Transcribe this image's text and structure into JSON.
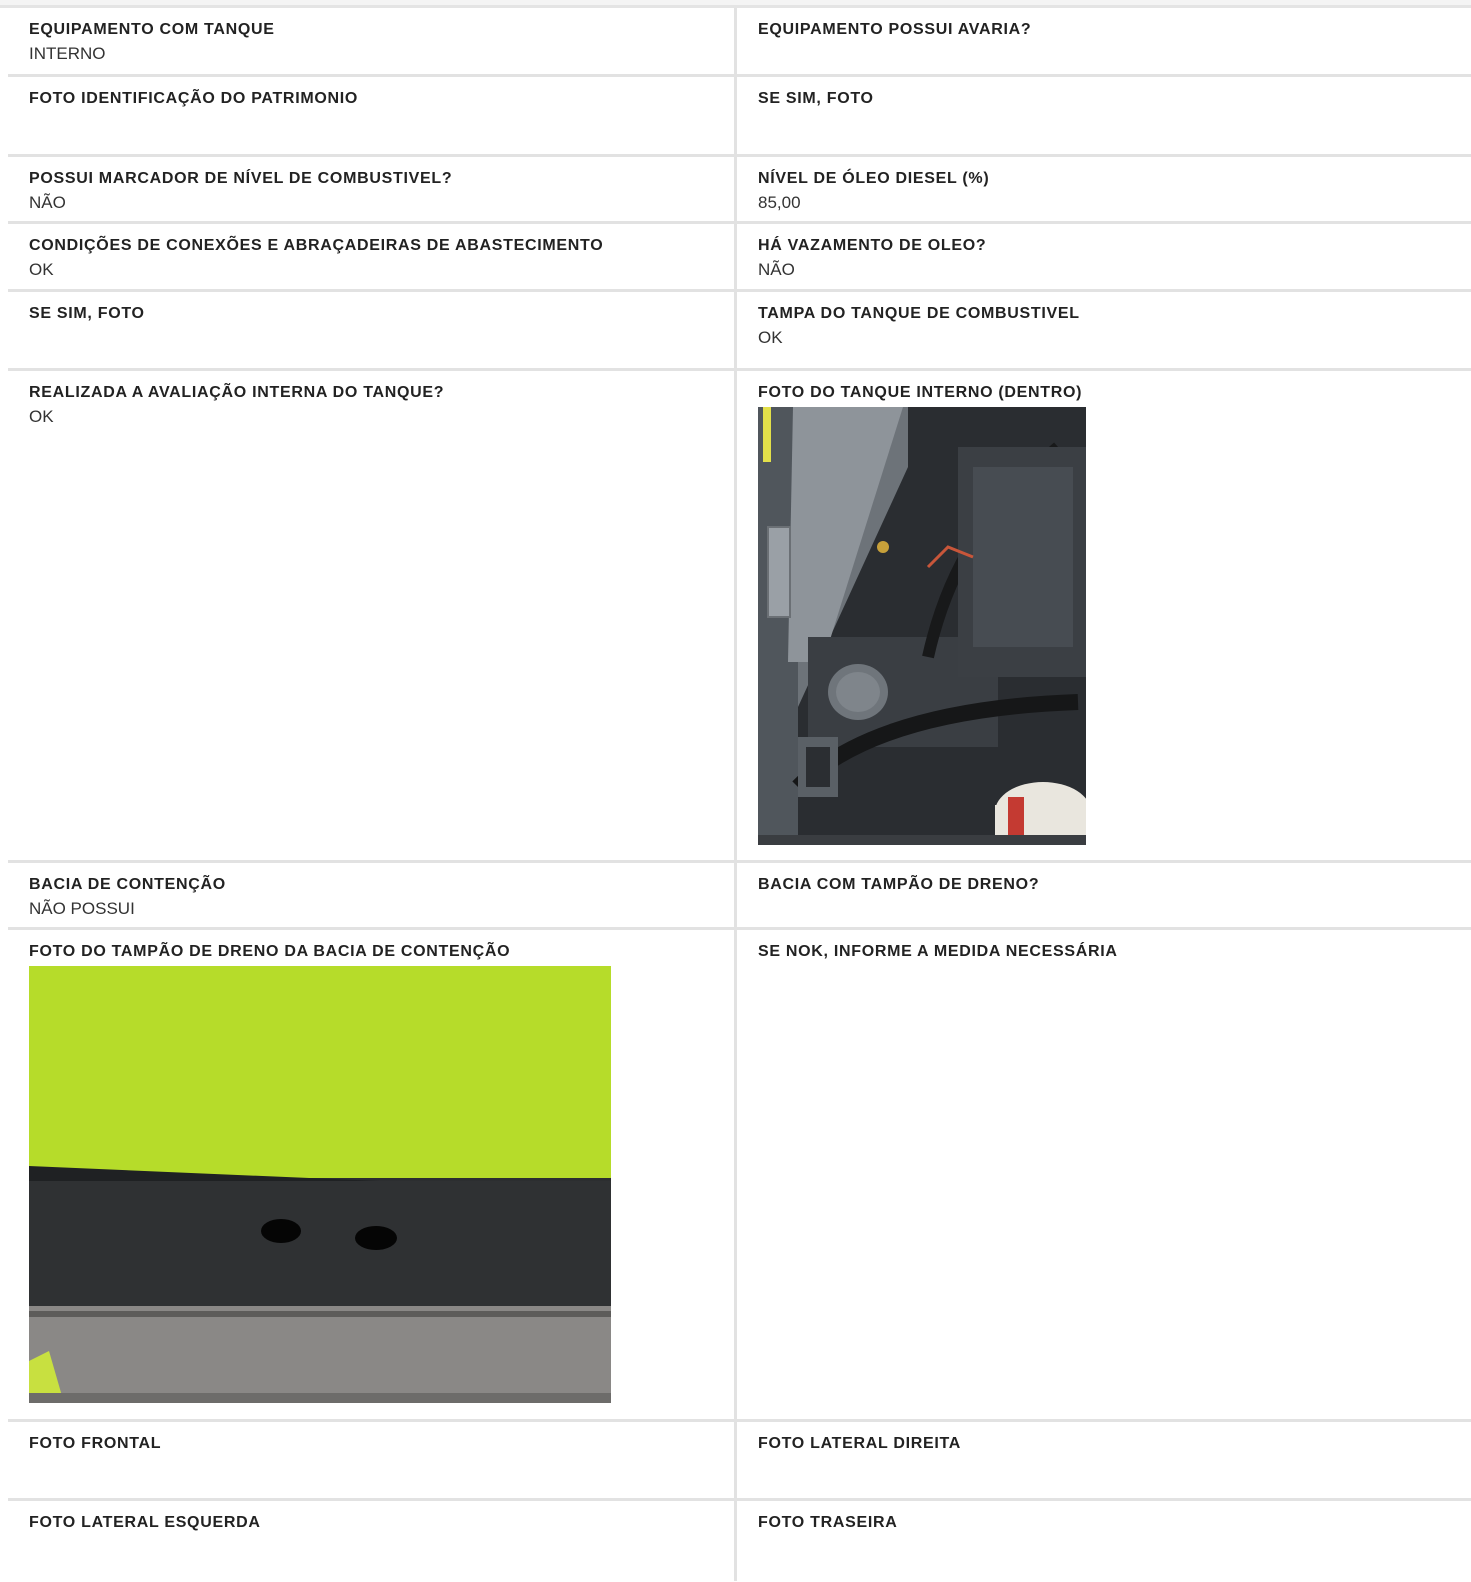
{
  "rows": [
    {
      "left": {
        "label": "EQUIPAMENTO COM TANQUE",
        "value": "INTERNO"
      },
      "right": {
        "label": "EQUIPAMENTO POSSUI AVARIA?",
        "value": ""
      }
    },
    {
      "left": {
        "label": "FOTO IDENTIFICAÇÃO DO PATRIMONIO",
        "value": ""
      },
      "right": {
        "label": "SE SIM, FOTO",
        "value": ""
      }
    },
    {
      "left": {
        "label": "POSSUI MARCADOR DE NÍVEL DE COMBUSTIVEL?",
        "value": "NÃO"
      },
      "right": {
        "label": "NÍVEL DE ÓLEO DIESEL (%)",
        "value": "85,00"
      }
    },
    {
      "left": {
        "label": "CONDIÇÕES DE CONEXÕES E ABRAÇADEIRAS DE ABASTECIMENTO",
        "value": "OK"
      },
      "right": {
        "label": "HÁ VAZAMENTO DE OLEO?",
        "value": "NÃO"
      }
    },
    {
      "left": {
        "label": "SE SIM, FOTO",
        "value": ""
      },
      "right": {
        "label": "TAMPA DO TANQUE DE COMBUSTIVEL",
        "value": "OK"
      }
    },
    {
      "left": {
        "label": "REALIZADA A AVALIAÇÃO INTERNA DO TANQUE?",
        "value": "OK"
      },
      "right": {
        "label": "FOTO DO TANQUE INTERNO (DENTRO)",
        "value": ""
      }
    },
    {
      "left": {
        "label": "BACIA DE CONTENÇÃO",
        "value": "NÃO POSSUI"
      },
      "right": {
        "label": "BACIA COM TAMPÃO DE DRENO?",
        "value": ""
      }
    },
    {
      "left": {
        "label": "FOTO DO TAMPÃO DE DRENO DA BACIA DE CONTENÇÃO",
        "value": ""
      },
      "right": {
        "label": "SE NOK, INFORME A MEDIDA NECESSÁRIA",
        "value": ""
      }
    },
    {
      "left": {
        "label": "FOTO FRONTAL",
        "value": ""
      },
      "right": {
        "label": "FOTO LATERAL DIREITA",
        "value": ""
      }
    },
    {
      "left": {
        "label": "FOTO LATERAL ESQUERDA",
        "value": ""
      },
      "right": {
        "label": "FOTO TRASEIRA",
        "value": ""
      }
    }
  ],
  "colors": {
    "border": "#e2e2e2",
    "label": "#222222",
    "value": "#333333",
    "drain_green": "#b6dc2a",
    "drain_black": "#2c2e30"
  }
}
